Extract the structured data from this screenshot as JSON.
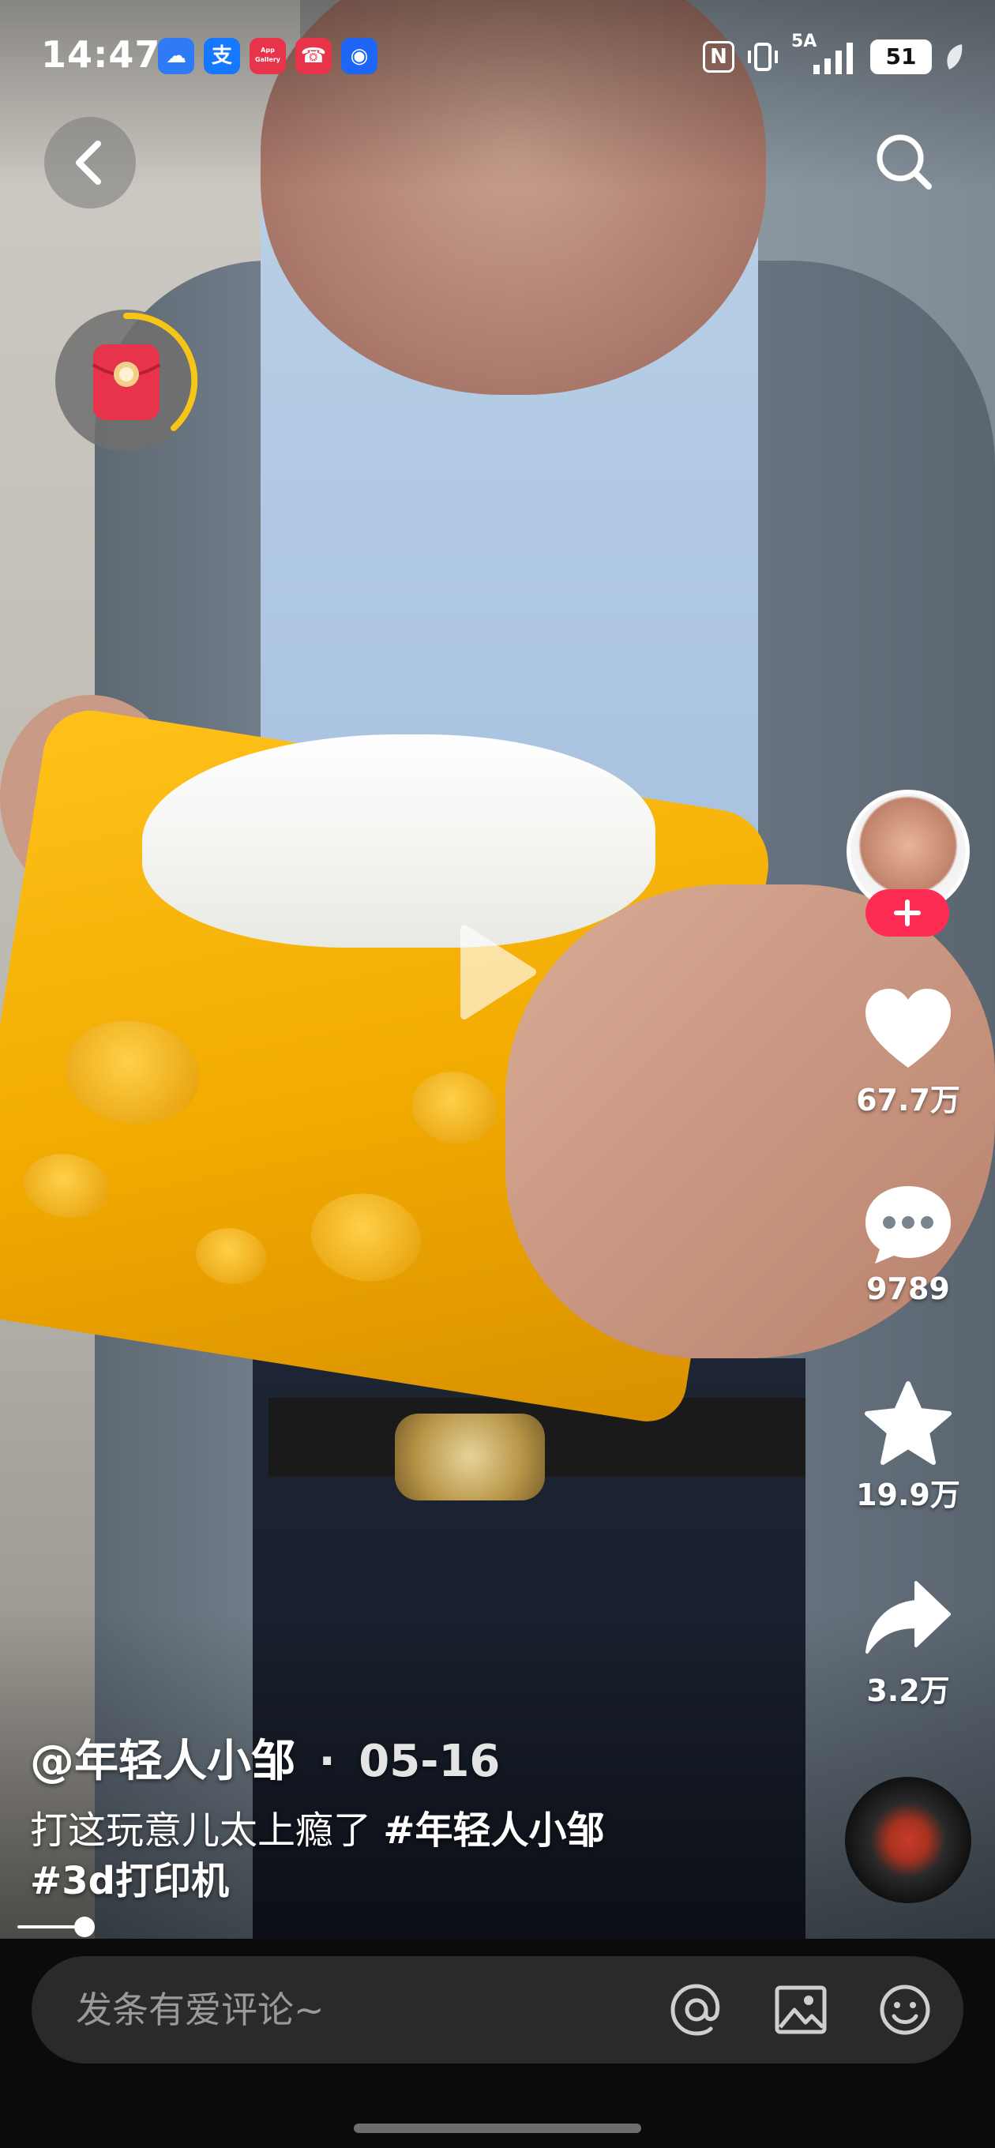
{
  "status_bar": {
    "time": "14:47",
    "app_icons": [
      {
        "name": "weather-icon",
        "color": "#2f7bf5",
        "glyph": "☁"
      },
      {
        "name": "alipay-icon",
        "color": "#1677ff",
        "glyph": "支"
      },
      {
        "name": "app-gallery-icon",
        "color": "#e8344a",
        "glyph": "App Gallery"
      },
      {
        "name": "missed-call-icon",
        "color": "#e8344a",
        "glyph": "☎"
      },
      {
        "name": "bulb-icon",
        "color": "#1e66f5",
        "glyph": "◉"
      }
    ],
    "nfc_label": "N",
    "network_label": "5A",
    "battery_level": "51"
  },
  "video": {
    "author": "@年轻人小邹",
    "separator": "·",
    "date": "05-16",
    "caption_text": "打这玩意儿太上瘾了 ",
    "hashtags": [
      "#年轻人小邹",
      "#3d打印机"
    ],
    "progress_fraction": 0.045
  },
  "actions": {
    "likes": "67.7万",
    "comments": "9789",
    "favorites": "19.9万",
    "shares": "3.2万"
  },
  "comment_bar": {
    "placeholder": "发条有爱评论~"
  },
  "colors": {
    "accent": "#fe2c55",
    "redpacket": "#e8344a",
    "ring": "#f5c518"
  }
}
